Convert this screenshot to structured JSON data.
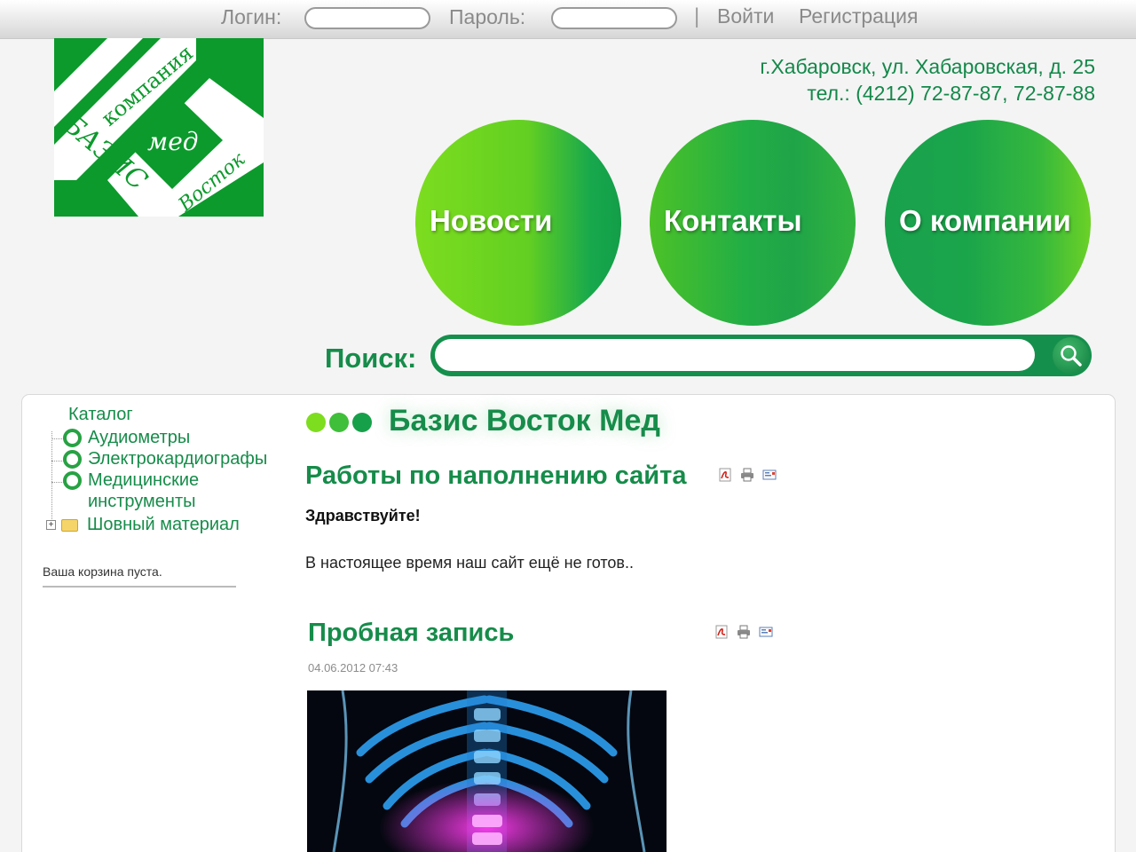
{
  "login": {
    "login_label": "Логин:",
    "login_value": "",
    "password_label": "Пароль:",
    "password_value": "",
    "separator": "|",
    "signin": "Войти",
    "register": "Регистрация"
  },
  "logo": {
    "text_company": "компания",
    "text_basis": "БАЗИС",
    "text_med": "мед",
    "text_vostok": "Восток"
  },
  "contact": {
    "address": "г.Хабаровск, ул. Хабаровская, д. 25",
    "phones": "тел.: (4212) 72-87-87, 72-87-88"
  },
  "nav": {
    "items": [
      {
        "label": "Новости"
      },
      {
        "label": "Контакты"
      },
      {
        "label": "О компании"
      }
    ]
  },
  "search": {
    "label": "Поиск:",
    "value": ""
  },
  "sidebar": {
    "catalog_title": "Каталог",
    "items": [
      {
        "label": "Аудиометры"
      },
      {
        "label": "Электрокардиографы"
      },
      {
        "label": "Медицинские инструменты"
      },
      {
        "label": "Шовный материал"
      }
    ],
    "cart_text": "Ваша корзина пуста."
  },
  "main": {
    "site_title": "Базис Восток Мед",
    "article1": {
      "title": "Работы по наполнению сайта",
      "greeting": "Здравствуйте!",
      "body": "В настоящее время наш сайт ещё не готов.."
    },
    "article2": {
      "title": "Пробная запись",
      "date": "04.06.2012 07:43"
    }
  },
  "colors": {
    "brand_green": "#168c4a",
    "light_green": "#7ddd1f",
    "dot1": "#7ddd1f",
    "dot2": "#3fbf3a",
    "dot3": "#17a04a"
  },
  "icons": {
    "pdf": "pdf-icon",
    "print": "print-icon",
    "email": "email-icon",
    "search": "magnifier-icon"
  }
}
